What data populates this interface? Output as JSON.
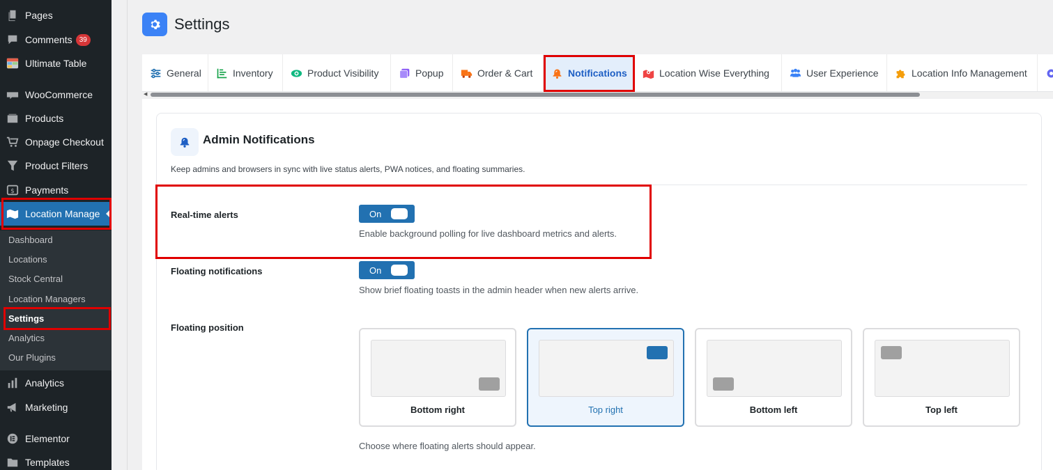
{
  "sidebar": {
    "items": [
      {
        "label": "Pages",
        "icon": "pages-icon"
      },
      {
        "label": "Comments",
        "icon": "comments-icon",
        "badge": "39"
      },
      {
        "label": "Ultimate Table",
        "icon": "table-icon"
      },
      {
        "label": "WooCommerce",
        "icon": "woocommerce-icon"
      },
      {
        "label": "Products",
        "icon": "products-icon"
      },
      {
        "label": "Onpage Checkout",
        "icon": "cart-icon"
      },
      {
        "label": "Product Filters",
        "icon": "filter-icon"
      },
      {
        "label": "Payments",
        "icon": "payments-icon"
      },
      {
        "label": "Location Manage",
        "icon": "map-icon"
      },
      {
        "label": "Analytics",
        "icon": "analytics-icon"
      },
      {
        "label": "Marketing",
        "icon": "megaphone-icon"
      },
      {
        "label": "Elementor",
        "icon": "elementor-icon"
      },
      {
        "label": "Templates",
        "icon": "folder-icon"
      }
    ],
    "submenu": [
      "Dashboard",
      "Locations",
      "Stock Central",
      "Location Managers",
      "Settings",
      "Analytics",
      "Our Plugins"
    ]
  },
  "header": {
    "title": "Settings",
    "icon": "gear-icon"
  },
  "tabs": [
    {
      "label": "General",
      "icon": "sliders-icon",
      "color": "#2271b1"
    },
    {
      "label": "Inventory",
      "icon": "inventory-chart-icon",
      "color": "#16a34a"
    },
    {
      "label": "Product Visibility",
      "icon": "eye-icon",
      "color": "#10b981"
    },
    {
      "label": "Popup",
      "icon": "popup-icon",
      "color": "#8b5cf6"
    },
    {
      "label": "Order & Cart",
      "icon": "truck-icon",
      "color": "#f97316"
    },
    {
      "label": "Notifications",
      "icon": "bell-icon",
      "color": "#f97316"
    },
    {
      "label": "Location Wise Everything",
      "icon": "map-marker-icon",
      "color": "#dc2626"
    },
    {
      "label": "User Experience",
      "icon": "users-icon",
      "color": "#3b82f6"
    },
    {
      "label": "Location Info Management",
      "icon": "puzzle-icon",
      "color": "#f59e0b"
    }
  ],
  "section": {
    "title": "Admin Notifications",
    "icon": "bell-icon",
    "description": "Keep admins and browsers in sync with live status alerts, PWA notices, and floating summaries."
  },
  "fields": {
    "realtime": {
      "label": "Real-time alerts",
      "state": "On",
      "help": "Enable background polling for live dashboard metrics and alerts."
    },
    "floating": {
      "label": "Floating notifications",
      "state": "On",
      "help": "Show brief floating toasts in the admin header when new alerts arrive."
    },
    "position": {
      "label": "Floating position",
      "options": [
        "Bottom right",
        "Top right",
        "Bottom left",
        "Top left"
      ],
      "selected": "Top right",
      "help": "Choose where floating alerts should appear."
    }
  },
  "colors": {
    "accent": "#2271b1",
    "highlight": "#e00000",
    "header_icon_bg": "#3b82f6"
  }
}
